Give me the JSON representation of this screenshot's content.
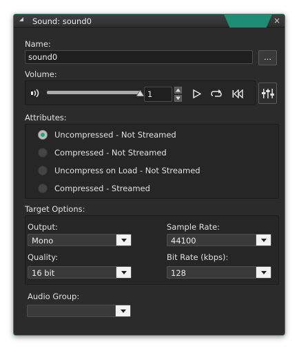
{
  "window": {
    "title": "Sound: sound0",
    "close_label": "×",
    "accent_color": "#1f8c74"
  },
  "name": {
    "label": "Name:",
    "value": "sound0",
    "browse_label": "..."
  },
  "volume": {
    "label": "Volume:",
    "level": 1,
    "level_text": "1",
    "speaker_icon": "speaker-icon",
    "play_icon": "play-icon",
    "loop_icon": "loop-icon",
    "rewind_icon": "rewind-icon",
    "mixer_icon": "mixer-icon"
  },
  "attributes": {
    "label": "Attributes:",
    "options": [
      {
        "label": "Uncompressed - Not Streamed",
        "selected": true
      },
      {
        "label": "Compressed - Not Streamed",
        "selected": false
      },
      {
        "label": "Uncompress on Load - Not Streamed",
        "selected": false
      },
      {
        "label": "Compressed - Streamed",
        "selected": false
      }
    ]
  },
  "target": {
    "label": "Target Options:",
    "output_label": "Output:",
    "output_value": "Mono",
    "sample_rate_label": "Sample Rate:",
    "sample_rate_value": "44100",
    "quality_label": "Quality:",
    "quality_value": "16 bit",
    "bit_rate_label": "Bit Rate (kbps):",
    "bit_rate_value": "128"
  },
  "audio_group": {
    "label": "Audio Group:",
    "value": ""
  }
}
